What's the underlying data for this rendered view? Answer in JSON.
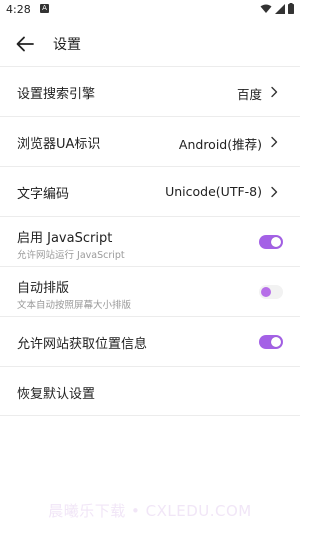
{
  "status_bar": {
    "time": "4:28",
    "notification_icon": "A",
    "icons": [
      "wifi-icon",
      "signal-icon",
      "battery-icon"
    ]
  },
  "appbar": {
    "back_icon": "arrow-left-icon",
    "title": "设置"
  },
  "settings": [
    {
      "id": "search-engine",
      "label": "设置搜索引擎",
      "value": "百度",
      "type": "nav"
    },
    {
      "id": "browser-ua",
      "label": "浏览器UA标识",
      "value": "Android(推荐)",
      "type": "nav"
    },
    {
      "id": "text-encoding",
      "label": "文字编码",
      "value": "Unicode(UTF-8)",
      "type": "nav"
    },
    {
      "id": "enable-javascript",
      "label": "启用 JavaScript",
      "sublabel": "允许网站运行 JavaScript",
      "type": "toggle",
      "enabled": true
    },
    {
      "id": "auto-layout",
      "label": "自动排版",
      "sublabel": "文本自动按照屏幕大小排版",
      "type": "toggle",
      "enabled": false
    },
    {
      "id": "allow-location",
      "label": "允许网站获取位置信息",
      "type": "toggle",
      "enabled": true
    },
    {
      "id": "restore-defaults",
      "label": "恢复默认设置",
      "type": "action"
    }
  ],
  "watermark": "晨曦乐下载 • CXLEDU.COM",
  "colors": {
    "accent": "#a461e6",
    "divider": "#ececec",
    "sublabel": "#9a9a9a"
  }
}
